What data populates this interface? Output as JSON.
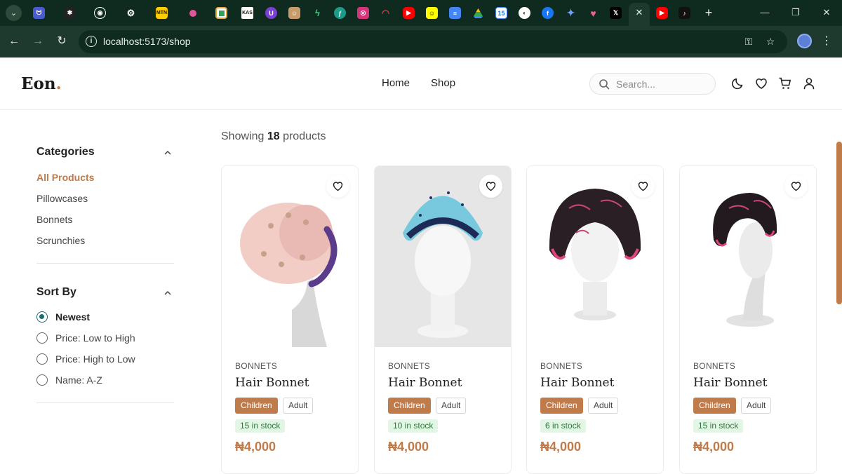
{
  "browser": {
    "url": "localhost:5173/shop",
    "tab_favicons": [
      "menu-icon",
      "linked-icon",
      "sparkle-icon",
      "github-icon",
      "openai-icon",
      "mtn-icon",
      "shape-icon",
      "photos-icon",
      "kas-icon",
      "u-icon",
      "avatar-icon",
      "bolt-icon",
      "f-icon",
      "instagram-icon",
      "arc-icon",
      "youtube-icon",
      "snapchat-icon",
      "docs-icon",
      "drive-icon",
      "calendar-icon",
      "ai-icon",
      "facebook-icon",
      "gemini-icon",
      "heart-app-icon",
      "x-icon",
      "close-icon",
      "youtube-icon",
      "tiktok-icon"
    ],
    "calendar_day": "15",
    "kas_label": "KAS"
  },
  "site": {
    "logo_text": "Eon",
    "logo_dot": ".",
    "nav": {
      "home": "Home",
      "shop": "Shop"
    },
    "search_placeholder": "Search...",
    "accent_color": "#c07b4a"
  },
  "sidebar": {
    "categories_title": "Categories",
    "categories": [
      "All Products",
      "Pillowcases",
      "Bonnets",
      "Scrunchies"
    ],
    "active_category": "All Products",
    "sort_title": "Sort By",
    "sort_options": [
      "Newest",
      "Price: Low to High",
      "Price: High to Low",
      "Name: A-Z"
    ],
    "selected_sort": "Newest"
  },
  "results": {
    "prefix": "Showing",
    "count": "18",
    "suffix": "products"
  },
  "products": [
    {
      "category": "BONNETS",
      "name": "Hair Bonnet",
      "size_options": [
        "Children",
        "Adult"
      ],
      "selected_size": "Children",
      "stock": "15 in stock",
      "price": "₦4,000",
      "color": "pink"
    },
    {
      "category": "BONNETS",
      "name": "Hair Bonnet",
      "size_options": [
        "Children",
        "Adult"
      ],
      "selected_size": "Children",
      "stock": "10 in stock",
      "price": "₦4,000",
      "color": "blue"
    },
    {
      "category": "BONNETS",
      "name": "Hair Bonnet",
      "size_options": [
        "Children",
        "Adult"
      ],
      "selected_size": "Children",
      "stock": "6 in stock",
      "price": "₦4,000",
      "color": "black-pink"
    },
    {
      "category": "BONNETS",
      "name": "Hair Bonnet",
      "size_options": [
        "Children",
        "Adult"
      ],
      "selected_size": "Children",
      "stock": "15 in stock",
      "price": "₦4,000",
      "color": "black-pink"
    }
  ]
}
